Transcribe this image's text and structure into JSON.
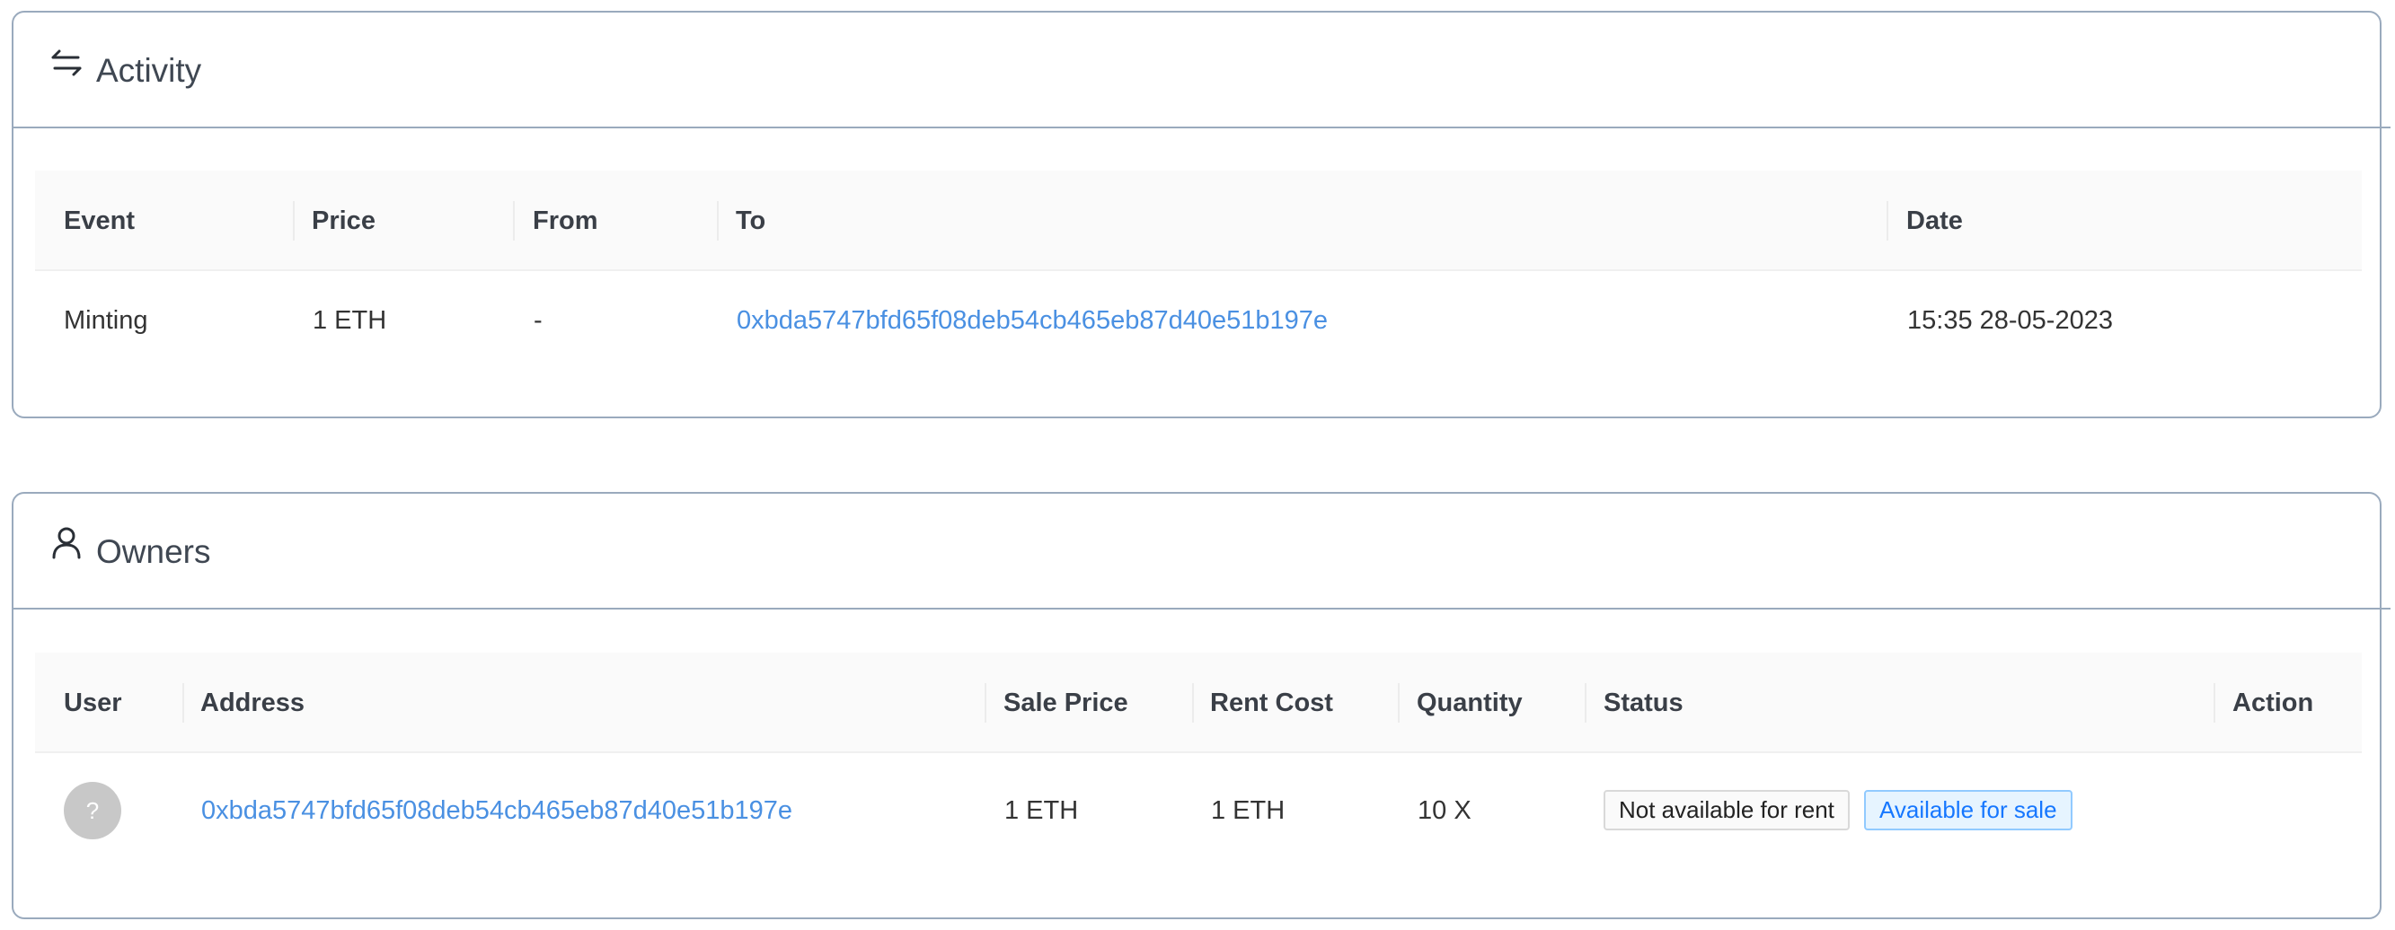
{
  "activity": {
    "title": "Activity",
    "icon": "swap-arrows-icon",
    "columns": [
      "Event",
      "Price",
      "From",
      "To",
      "Date"
    ],
    "rows": [
      {
        "event": "Minting",
        "price": "1 ETH",
        "from": "-",
        "to": "0xbda5747bfd65f08deb54cb465eb87d40e51b197e",
        "date": "15:35 28-05-2023"
      }
    ]
  },
  "owners": {
    "title": "Owners",
    "icon": "user-icon",
    "columns": [
      "User",
      "Address",
      "Sale Price",
      "Rent Cost",
      "Quantity",
      "Status",
      "Action"
    ],
    "rows": [
      {
        "avatar": "?",
        "address": "0xbda5747bfd65f08deb54cb465eb87d40e51b197e",
        "sale_price": "1 ETH",
        "rent_cost": "1 ETH",
        "quantity": "10 X",
        "status_tags": [
          "Not available for rent",
          "Available for sale"
        ]
      }
    ]
  },
  "colors": {
    "link": "#4a90e2",
    "card_border": "#9aaabd",
    "sale_tag": "#1677ff"
  }
}
